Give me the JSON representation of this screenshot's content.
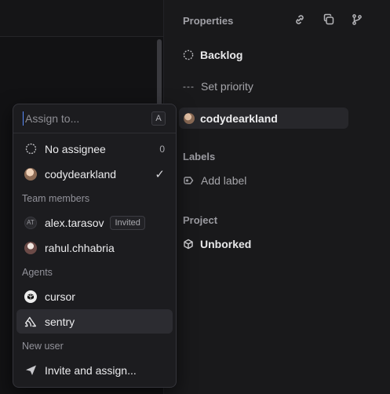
{
  "properties": {
    "title": "Properties",
    "status": "Backlog",
    "priority": "Set priority",
    "assignee": "codydearkland",
    "labels_title": "Labels",
    "add_label": "Add label",
    "project_title": "Project",
    "project": "Unborked"
  },
  "header_icons": [
    "link-icon",
    "copy-icon",
    "branch-icon"
  ],
  "dropdown": {
    "placeholder": "Assign to...",
    "shortcut": "A",
    "no_assignee": {
      "label": "No assignee",
      "count": "0"
    },
    "current": {
      "label": "codydearkland",
      "checkmark": "✓"
    },
    "team_heading": "Team members",
    "team": [
      {
        "initials": "AT",
        "label": "alex.tarasov",
        "badge": "Invited"
      },
      {
        "label": "rahul.chhabria"
      }
    ],
    "agents_heading": "Agents",
    "agents": [
      {
        "label": "cursor",
        "icon": "cursor-icon"
      },
      {
        "label": "sentry",
        "icon": "sentry-icon"
      }
    ],
    "new_user_heading": "New user",
    "invite": "Invite and assign..."
  },
  "colors": {
    "accent": "#5a8cff",
    "panel": "#1c1c1f",
    "background": "#101012"
  }
}
